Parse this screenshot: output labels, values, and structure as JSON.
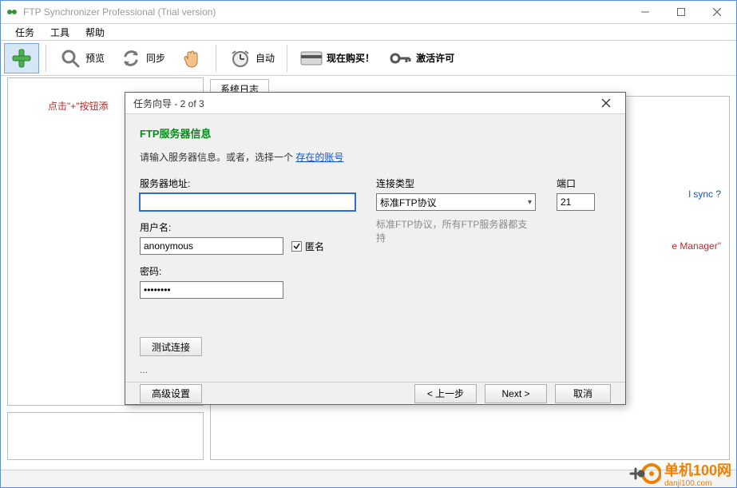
{
  "window": {
    "title": "FTP Synchronizer Professional (Trial version)"
  },
  "menu": {
    "items": [
      "任务",
      "工具",
      "帮助"
    ]
  },
  "toolbar": {
    "add": "",
    "preview": "预览",
    "sync": "同步",
    "hand": "",
    "auto": "自动",
    "buy": "现在购买！",
    "activate": "激活许可"
  },
  "left_panel": {
    "hint": "点击\"+\"按钮添"
  },
  "main_tab": {
    "label": "系统日志",
    "bg_link_a": "l sync ?",
    "bg_link_b": "e Manager\""
  },
  "dialog": {
    "title": "任务向导 - 2 of 3",
    "heading": "FTP服务器信息",
    "desc_prefix": "请输入服务器信息。或者，选择一个 ",
    "desc_link": "存在的账号",
    "server_label": "服务器地址:",
    "server_value": "",
    "user_label": "用户名:",
    "user_value": "anonymous",
    "anon_label": "匿名",
    "anon_checked": true,
    "pwd_label": "密码:",
    "pwd_value": "••••••••",
    "conn_type_label": "连接类型",
    "conn_type_selected": "标准FTP协议",
    "conn_type_help": "标准FTP协议，所有FTP服务器都支持",
    "port_label": "端口",
    "port_value": "21",
    "test_btn": "测试连接",
    "ellipsis": "...",
    "advanced_btn": "高级设置",
    "back_btn": "< 上一步",
    "next_btn": "Next >",
    "cancel_btn": "取消"
  },
  "watermark": {
    "brand": "单机100网",
    "url": "danji100.com"
  }
}
